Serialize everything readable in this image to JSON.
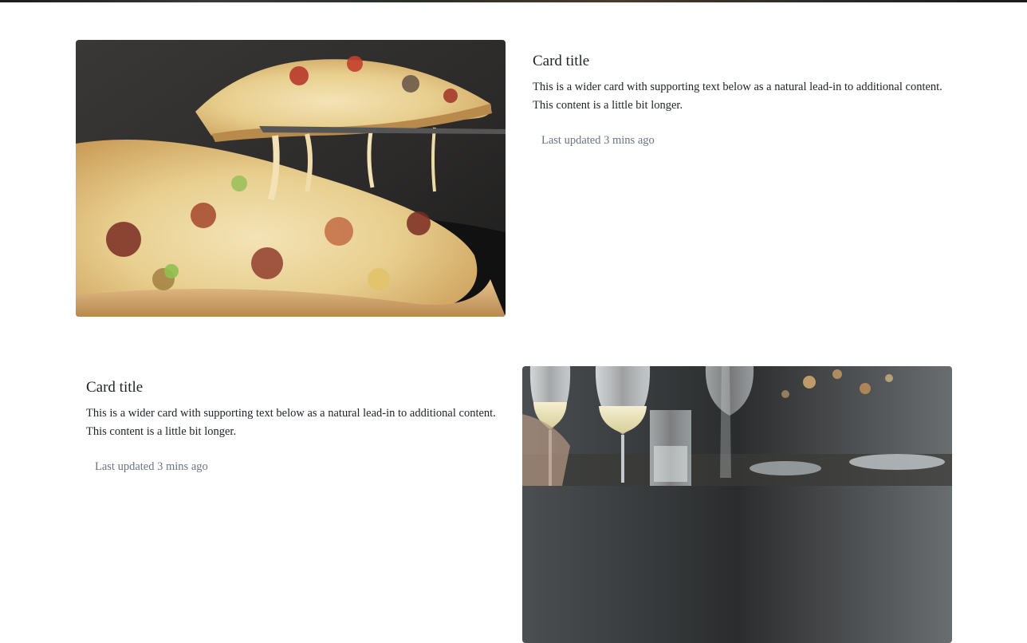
{
  "cards": [
    {
      "image_alt": "pizza-photo",
      "title": "Card title",
      "text": "This is a wider card with supporting text below as a natural lead-in to additional content. This content is a little bit longer.",
      "meta": "Last updated 3 mins ago"
    },
    {
      "image_alt": "restaurant-table-photo",
      "title": "Card title",
      "text": "This is a wider card with supporting text below as a natural lead-in to additional content. This content is a little bit longer.",
      "meta": "Last updated 3 mins ago"
    }
  ]
}
